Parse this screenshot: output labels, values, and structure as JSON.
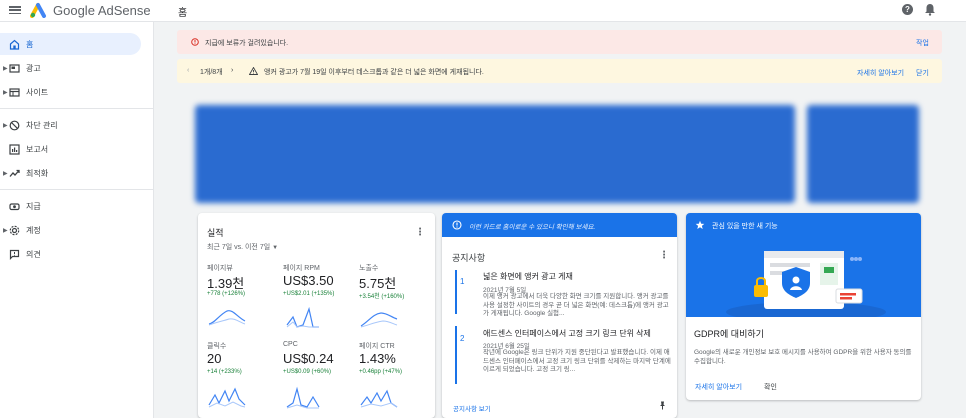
{
  "app": {
    "name": "Google AdSense",
    "page_title": "홈"
  },
  "colors": {
    "brand_blue": "#1a73e8",
    "error_bg": "#fce8e6",
    "warning_bg": "#fef7e0",
    "positive": "#188038"
  },
  "sidebar": {
    "items": [
      {
        "label": "홈",
        "icon": "home-icon"
      },
      {
        "label": "광고",
        "icon": "ads-icon"
      },
      {
        "label": "사이트",
        "icon": "sites-icon"
      },
      {
        "label": "차단 관리",
        "icon": "block-icon"
      },
      {
        "label": "보고서",
        "icon": "reports-icon"
      },
      {
        "label": "최적화",
        "icon": "optimize-icon"
      },
      {
        "label": "지급",
        "icon": "payments-icon"
      },
      {
        "label": "계정",
        "icon": "account-icon"
      },
      {
        "label": "의견",
        "icon": "feedback-icon"
      }
    ]
  },
  "alerts": {
    "payment_hold": {
      "text": "지급에 보류가 걸려있습니다.",
      "action": "작업"
    },
    "notice": {
      "pager": "1개/8개",
      "text": "앵커 광고가 7월 19일 이후부터 데스크톱과 같은 더 넓은 화면에 게재됩니다.",
      "learn_more": "자세히 알아보기",
      "close": "닫기"
    }
  },
  "performance": {
    "title": "실적",
    "range": "최근 7일 vs. 이전 7일",
    "metrics": [
      {
        "label": "페이지뷰",
        "value": "1.39천",
        "change": "+778 (+126%)"
      },
      {
        "label": "페이지 RPM",
        "value": "US$3.50",
        "change": "+US$2.01 (+135%)"
      },
      {
        "label": "노출수",
        "value": "5.75천",
        "change": "+3.54천 (+160%)"
      },
      {
        "label": "클릭수",
        "value": "20",
        "change": "+14 (+233%)"
      },
      {
        "label": "CPC",
        "value": "US$0.24",
        "change": "+US$0.09 (+60%)"
      },
      {
        "label": "페이지 CTR",
        "value": "1.43%",
        "change": "+0.46pp (+47%)"
      }
    ]
  },
  "notices": {
    "header": "이런 카드로 홈이로운 수 있으니 확인해 보세요.",
    "title": "공지사항",
    "items": [
      {
        "num": "1",
        "title": "넓은 화면에 앵커 광고 게재",
        "date": "2021년 7월 5일",
        "body": "이제 앵커 광고에서 더욱 다양한 화면 크기를 지원합니다. 앵커 광고를 사용 설정한 사이트의 경우 곧 더 넓은 화면(예: 데스크톱)에 앵커 광고가 게재됩니다. Google 실험..."
      },
      {
        "num": "2",
        "title": "애드센스 인터페이스에서 고정 크기 링크 단위 삭제",
        "date": "2021년 6월 25일",
        "body": "작년에 Google은 링크 단위가 지원 중단된다고 발표했습니다. 이제 애드센스 인터페이스에서 고정 크기 링크 단위를 삭제하는 마지막 단계에 이르게 되었습니다. 고정 크기 링..."
      }
    ],
    "view_all": "공지사항 보기"
  },
  "feature": {
    "header": "관심 있을 만한 새 기능",
    "title": "GDPR에 대비하기",
    "body": "Google의 새로운 개인정보 보호 메시지를 사용하여 GDPR을 위한 사용자 동의를 수집합니다.",
    "learn_more": "자세히 알아보기",
    "confirm": "확인"
  }
}
